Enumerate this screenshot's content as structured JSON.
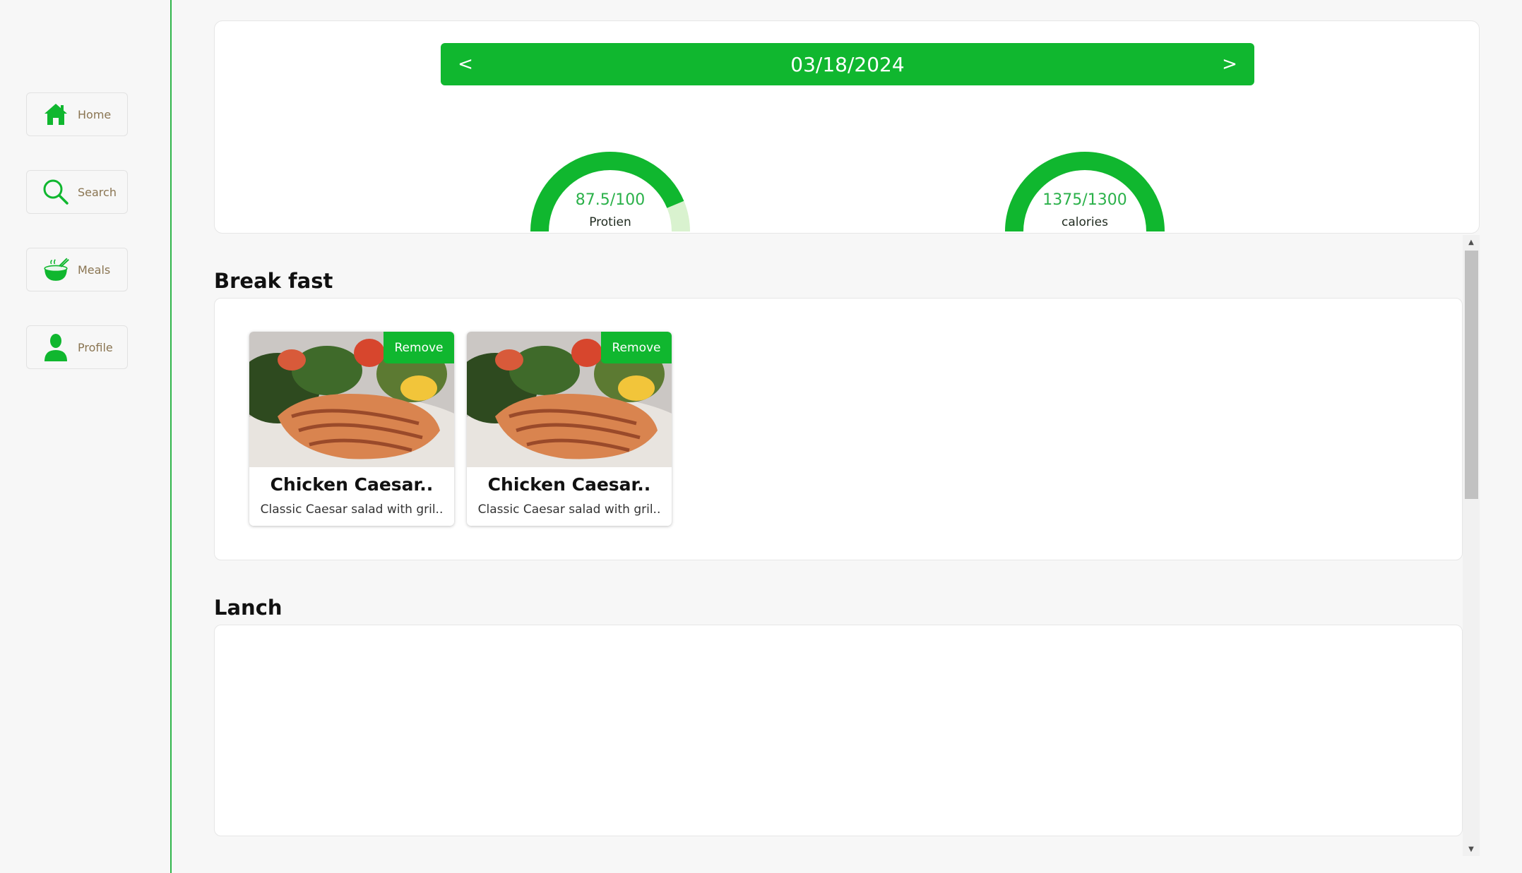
{
  "sidebar": {
    "items": [
      {
        "label": "Home",
        "icon": "home-icon"
      },
      {
        "label": "Search",
        "icon": "search-icon"
      },
      {
        "label": "Meals",
        "icon": "bowl-icon"
      },
      {
        "label": "Profile",
        "icon": "user-icon"
      }
    ]
  },
  "date_nav": {
    "prev": "<",
    "date": "03/18/2024",
    "next": ">"
  },
  "gauges": {
    "protein": {
      "value": "87.5/100",
      "label": "Protien",
      "fraction": 0.875
    },
    "calories": {
      "value": "1375/1300",
      "label": "calories",
      "fraction": 1.0
    }
  },
  "sections": {
    "breakfast": {
      "title": "Break fast",
      "meals": [
        {
          "title": "Chicken Caesar..",
          "desc": "Classic Caesar salad with gril..",
          "remove": "Remove"
        },
        {
          "title": "Chicken Caesar..",
          "desc": "Classic Caesar salad with gril..",
          "remove": "Remove"
        }
      ]
    },
    "lunch": {
      "title": "Lanch"
    }
  },
  "colors": {
    "accent": "#10b72f",
    "gauge_track": "#d9f2cf",
    "sidebar_text": "#8a7552"
  }
}
